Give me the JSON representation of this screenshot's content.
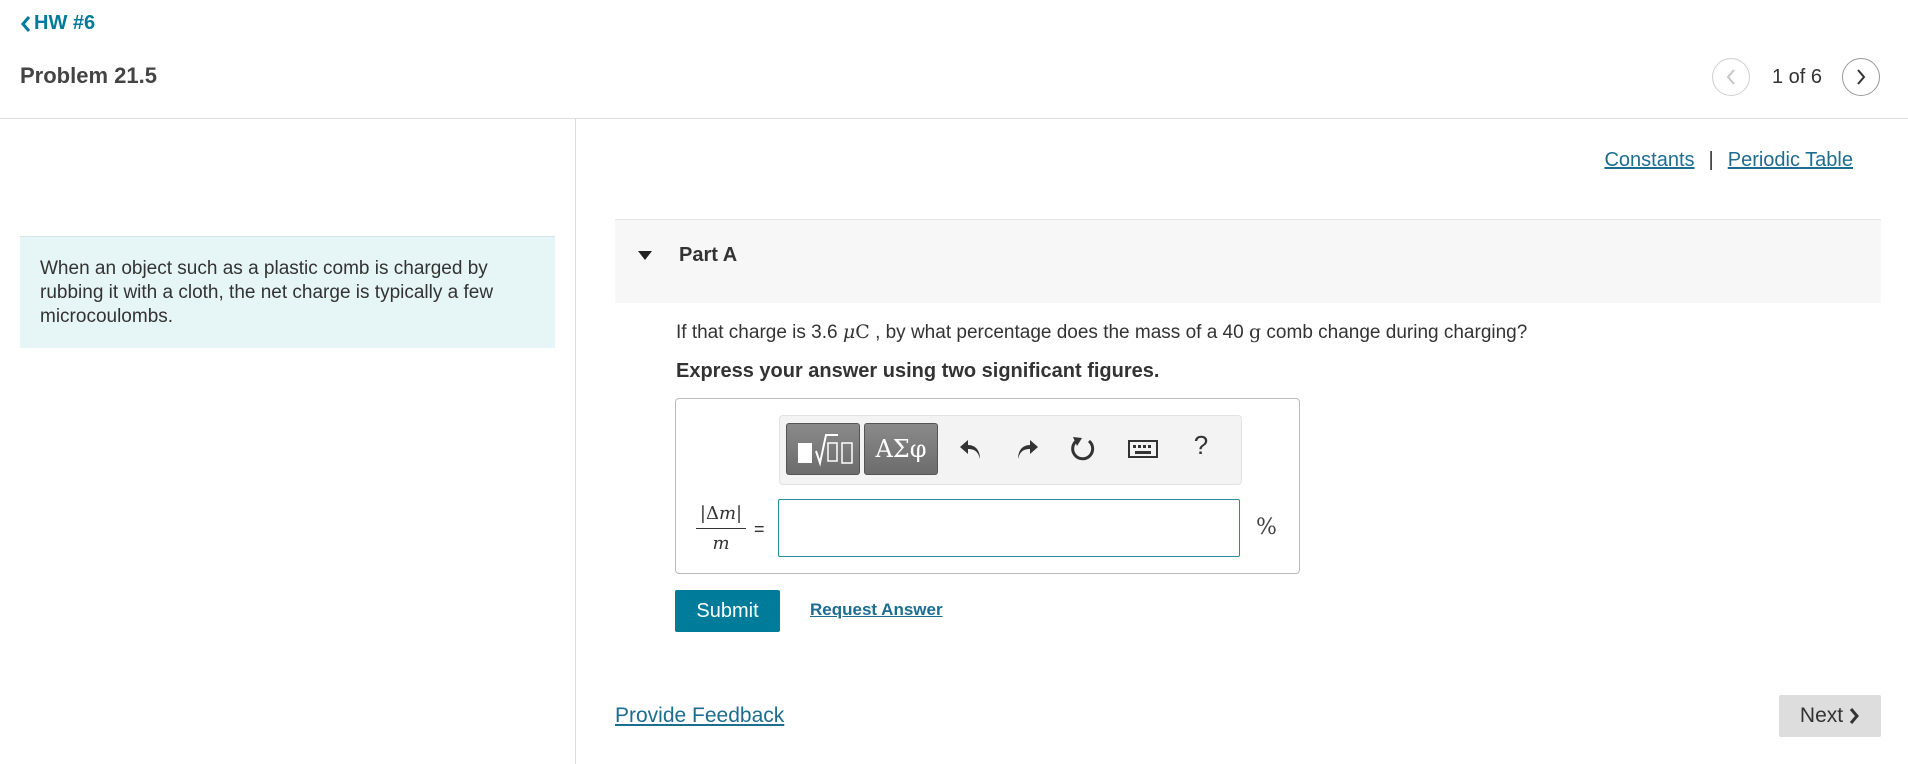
{
  "nav": {
    "back_label": "HW #6",
    "problem_title": "Problem 21.5",
    "pager": {
      "current_text": "1 of 6"
    }
  },
  "intro": {
    "text": "When an object such as a plastic comb is charged by rubbing it with a cloth, the net charge is typically a few microcoulombs."
  },
  "references": {
    "constants_label": "Constants",
    "separator": "|",
    "periodic_table_label": "Periodic Table"
  },
  "part": {
    "title": "Part A",
    "question": {
      "prefix": "If that charge is 3.6",
      "charge_unit_mu": "μ",
      "charge_unit_c": "C",
      "middle": ", by what percentage does the mass of a 40",
      "mass_unit": "g",
      "suffix": "comb change during charging?"
    },
    "instruction": "Express your answer using two significant figures.",
    "toolbar": {
      "symbols_label": "ΑΣφ",
      "help_label": "?"
    },
    "answer": {
      "lhs_numerator_bar_left": "|",
      "lhs_numerator_delta": "Δ",
      "lhs_numerator_var": "m",
      "lhs_numerator_bar_right": "|",
      "lhs_denominator": "m",
      "equals": "=",
      "value": "",
      "unit": "%"
    },
    "submit_label": "Submit",
    "request_answer_label": "Request Answer"
  },
  "footer": {
    "feedback_label": "Provide Feedback",
    "next_label": "Next"
  },
  "colors": {
    "accent": "#007b9a",
    "link": "#1c6d8f",
    "intro_bg": "#e6f5f6"
  }
}
